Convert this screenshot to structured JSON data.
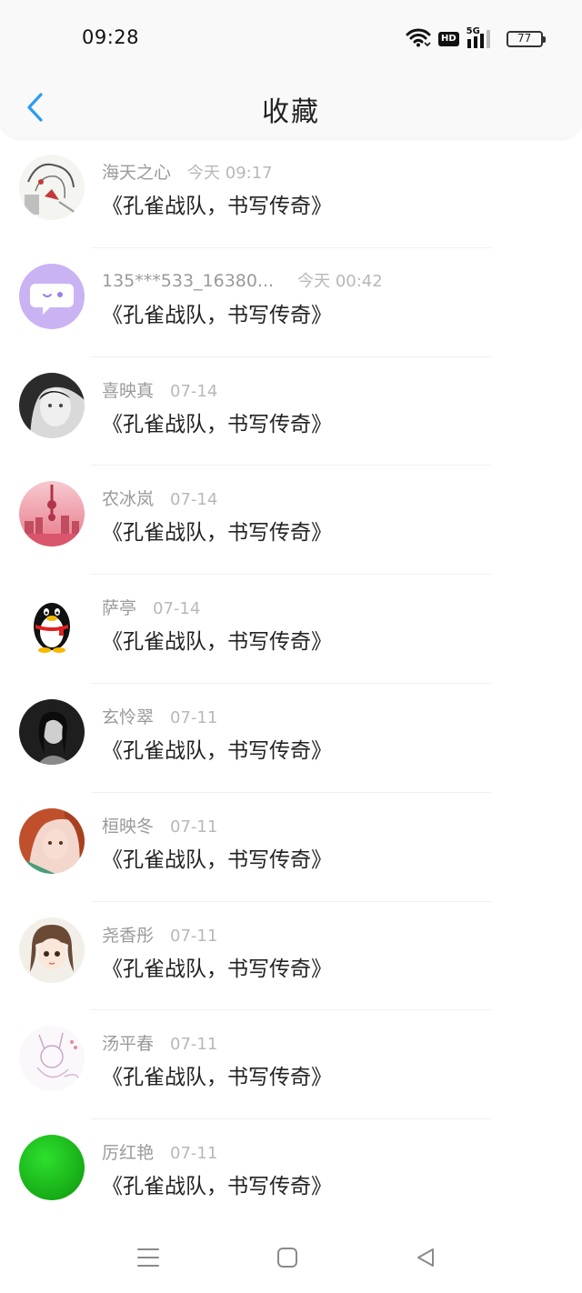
{
  "status_bar": {
    "time": "09:28",
    "network": "5G",
    "hd": "HD",
    "battery": "77"
  },
  "header": {
    "title": "收藏",
    "back_icon": "chevron-left-icon"
  },
  "colors": {
    "accent": "#2a9cf0",
    "name_gray": "#9a9a9a",
    "time_gray": "#b8b8b8"
  },
  "items": [
    {
      "name": "海天之心",
      "time": "今天 09:17",
      "title": "《孔雀战队，书写传奇》",
      "avatar": "sketch"
    },
    {
      "name": "135***533_16380...",
      "time": "今天 00:42",
      "title": "《孔雀战队，书写传奇》",
      "avatar": "chat-bubble"
    },
    {
      "name": "喜映真",
      "time": "07-14",
      "title": "《孔雀战队，书写传奇》",
      "avatar": "bw-portrait"
    },
    {
      "name": "农冰岚",
      "time": "07-14",
      "title": "《孔雀战队，书写传奇》",
      "avatar": "city-tower"
    },
    {
      "name": "萨亭",
      "time": "07-14",
      "title": "《孔雀战队，书写传奇》",
      "avatar": "qq-penguin"
    },
    {
      "name": "玄怜翠",
      "time": "07-11",
      "title": "《孔雀战队，书写传奇》",
      "avatar": "dark-portrait"
    },
    {
      "name": "桓映冬",
      "time": "07-11",
      "title": "《孔雀战队，书写传奇》",
      "avatar": "red-hair"
    },
    {
      "name": "尧香彤",
      "time": "07-11",
      "title": "《孔雀战队，书写传奇》",
      "avatar": "anime-girl"
    },
    {
      "name": "汤平春",
      "time": "07-11",
      "title": "《孔雀战队，书写传奇》",
      "avatar": "fox-sketch"
    },
    {
      "name": "厉红艳",
      "time": "07-11",
      "title": "《孔雀战队，书写传奇》",
      "avatar": "green-circle"
    }
  ],
  "nav_bar": {
    "menu_icon": "menu-icon",
    "home_icon": "home-square-icon",
    "back_icon": "back-triangle-icon"
  }
}
